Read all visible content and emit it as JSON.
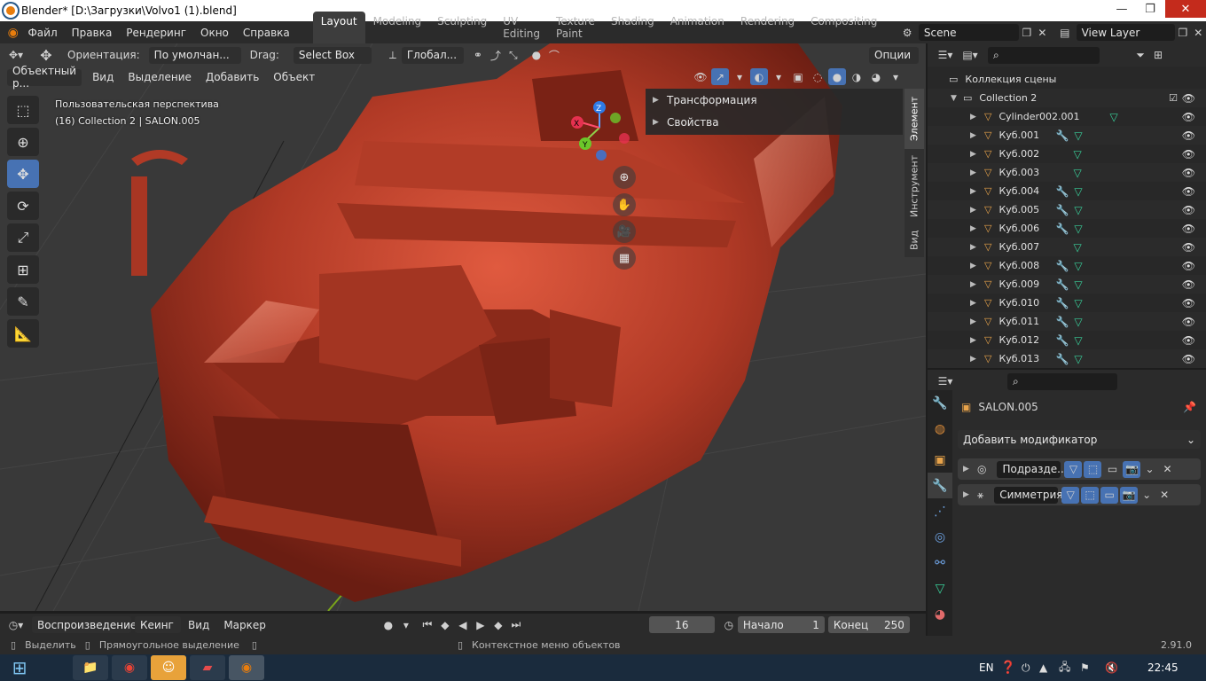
{
  "window": {
    "title": "Blender* [D:\\Загрузки\\Volvo1 (1).blend]"
  },
  "menu": [
    "Файл",
    "Правка",
    "Рендеринг",
    "Окно",
    "Справка"
  ],
  "workspaces": [
    "Layout",
    "Modeling",
    "Sculpting",
    "UV Editing",
    "Texture Paint",
    "Shading",
    "Animation",
    "Rendering",
    "Compositing"
  ],
  "active_workspace": "Layout",
  "scene": {
    "name": "Scene",
    "view_layer": "View Layer"
  },
  "viewport_header": {
    "orientation_label": "Ориентация:",
    "orientation_value": "По умолчан...",
    "drag_label": "Drag:",
    "drag_value": "Select Box",
    "transform_space": "Глобал...",
    "options": "Опции"
  },
  "viewport_header2": {
    "mode": "Объектный р...",
    "view": "Вид",
    "select": "Выделение",
    "add": "Добавить",
    "object": "Объект"
  },
  "viewport_overlay": {
    "perspective": "Пользовательская перспектива",
    "context": "(16) Collection 2 | SALON.005"
  },
  "gizmo_axes": {
    "z": "Z",
    "y": "Y",
    "x": "X"
  },
  "npanel": {
    "sections": [
      "Трансформация",
      "Свойства"
    ],
    "tabs": [
      "Элемент",
      "Инструмент",
      "Вид"
    ]
  },
  "outliner": {
    "scene_collection": "Коллекция сцены",
    "collection": "Collection 2",
    "items": [
      {
        "name": "Cylinder002.001",
        "modifier": false
      },
      {
        "name": "Куб.001",
        "modifier": true
      },
      {
        "name": "Куб.002",
        "modifier": false
      },
      {
        "name": "Куб.003",
        "modifier": false
      },
      {
        "name": "Куб.004",
        "modifier": true
      },
      {
        "name": "Куб.005",
        "modifier": true
      },
      {
        "name": "Куб.006",
        "modifier": true
      },
      {
        "name": "Куб.007",
        "modifier": false
      },
      {
        "name": "Куб.008",
        "modifier": true
      },
      {
        "name": "Куб.009",
        "modifier": true
      },
      {
        "name": "Куб.010",
        "modifier": true
      },
      {
        "name": "Куб.011",
        "modifier": true
      },
      {
        "name": "Куб.012",
        "modifier": true
      },
      {
        "name": "Куб.013",
        "modifier": true
      }
    ]
  },
  "properties": {
    "object_name": "SALON.005",
    "add_modifier": "Добавить модификатор",
    "modifiers": [
      "Подразде...",
      "Симметрия"
    ]
  },
  "timeline": {
    "playback": "Воспроизведение",
    "keying": "Кеинг",
    "view": "Вид",
    "marker": "Маркер",
    "current_frame": "16",
    "start_label": "Начало",
    "start": "1",
    "end_label": "Конец",
    "end": "250"
  },
  "statusbar": {
    "select": "Выделить",
    "box_select": "Прямоугольное выделение",
    "context_menu": "Контекстное меню объектов",
    "version": "2.91.0"
  },
  "taskbar": {
    "lang": "EN",
    "time": "22:45"
  },
  "colors": {
    "accent": "#4772b3",
    "model": "#c2412d",
    "grid": "#393939"
  }
}
